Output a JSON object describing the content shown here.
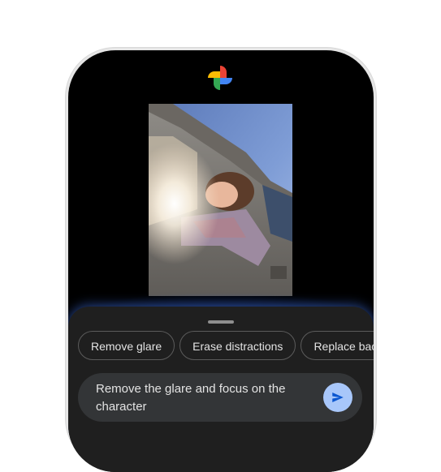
{
  "app": {
    "logo_icon": "google-photos-pinwheel-icon"
  },
  "photo": {
    "description_icon": "photo-woman-in-car-window"
  },
  "sheet": {
    "suggestions": [
      {
        "label": "Remove glare"
      },
      {
        "label": "Erase distractions"
      },
      {
        "label": "Replace background"
      }
    ],
    "prompt": {
      "value": "Remove the glare and focus on the character",
      "send_icon": "send-icon"
    }
  },
  "colors": {
    "sheet_bg": "#1f1f1f",
    "input_bg": "#333537",
    "send_bg": "#a8c7fa",
    "send_icon": "#0b57d0",
    "glow": "#4678e6"
  }
}
